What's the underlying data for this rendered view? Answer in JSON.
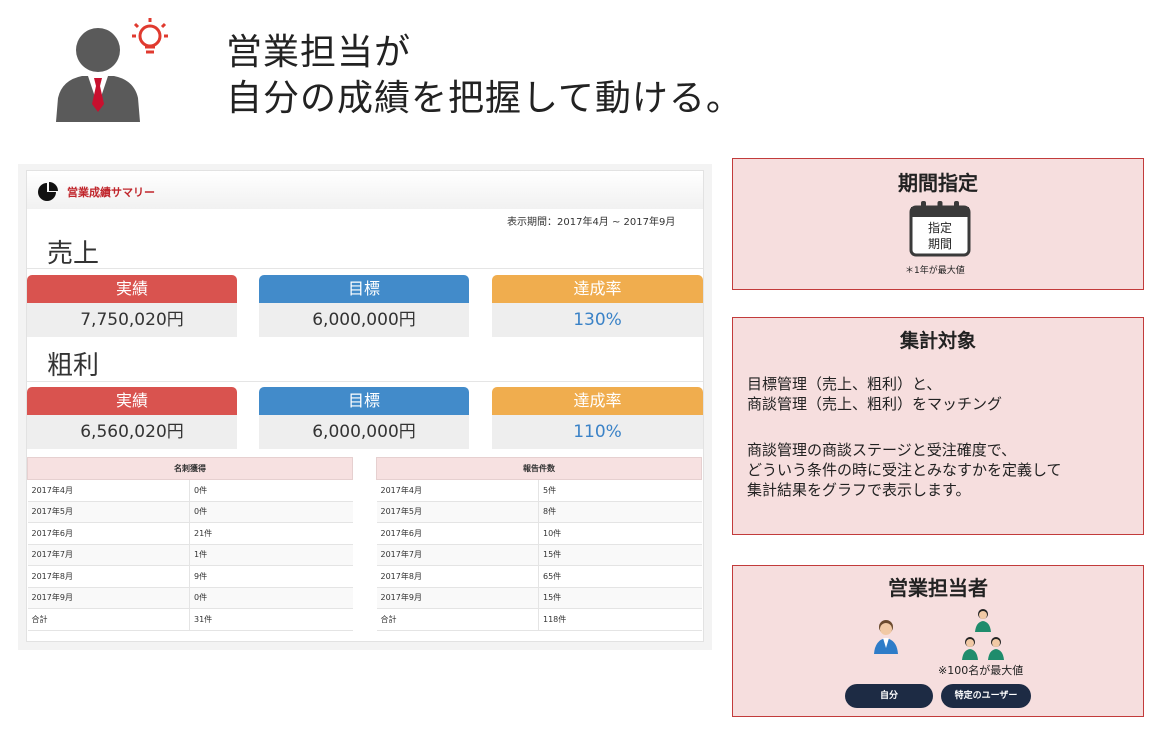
{
  "header": {
    "title_line1": "営業担当が",
    "title_line2": "自分の成績を把握して動ける。"
  },
  "summary": {
    "title": "営業成績サマリー",
    "period": "表示期間：2017年4月 ~ 2017年9月",
    "sales": {
      "heading": "売上",
      "actual_label": "実績",
      "actual_value": "7,750,020円",
      "target_label": "目標",
      "target_value": "6,000,000円",
      "rate_label": "達成率",
      "rate_value": "130%"
    },
    "profit": {
      "heading": "粗利",
      "actual_label": "実績",
      "actual_value": "6,560,020円",
      "target_label": "目標",
      "target_value": "6,000,000円",
      "rate_label": "達成率",
      "rate_value": "110%"
    },
    "table_left": {
      "header": "名刺獲得",
      "rows": [
        [
          "2017年4月",
          "0件"
        ],
        [
          "2017年5月",
          "0件"
        ],
        [
          "2017年6月",
          "21件"
        ],
        [
          "2017年7月",
          "1件"
        ],
        [
          "2017年8月",
          "9件"
        ],
        [
          "2017年9月",
          "0件"
        ],
        [
          "合計",
          "31件"
        ]
      ]
    },
    "table_right": {
      "header": "報告件数",
      "rows": [
        [
          "2017年4月",
          "5件"
        ],
        [
          "2017年5月",
          "8件"
        ],
        [
          "2017年6月",
          "10件"
        ],
        [
          "2017年7月",
          "15件"
        ],
        [
          "2017年8月",
          "65件"
        ],
        [
          "2017年9月",
          "15件"
        ],
        [
          "合計",
          "118件"
        ]
      ]
    }
  },
  "card_period": {
    "title": "期間指定",
    "calendar_text_1": "指定",
    "calendar_text_2": "期間",
    "note": "＊1年が最大値"
  },
  "card_target": {
    "title": "集計対象",
    "para1": "目標管理（売上、粗利）と、\n商談管理（売上、粗利）をマッチング",
    "para2": "商談管理の商談ステージと受注確度で、\nどういう条件の時に受注とみなすかを定義して\n集計結果をグラフで表示します。"
  },
  "card_staff": {
    "title": "営業担当者",
    "note": "※100名が最大値",
    "btn_self": "自分",
    "btn_users": "特定のユーザー"
  },
  "colors": {
    "actual": "#d9534f",
    "target": "#428bca",
    "rate": "#f0ad4e",
    "card_bg": "#f6dede",
    "card_border": "#c23b3b"
  }
}
